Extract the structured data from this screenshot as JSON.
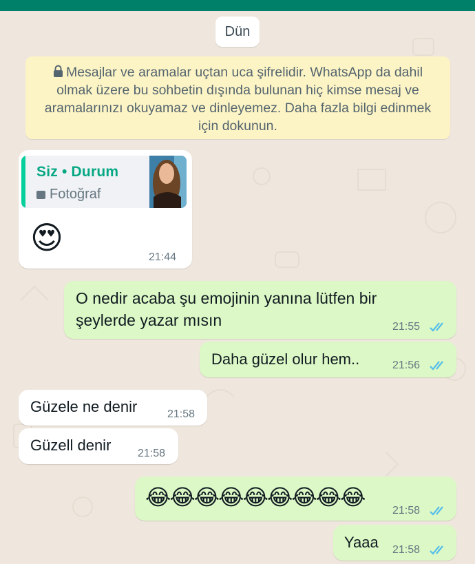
{
  "date_separator": "Dün",
  "encryption_notice": "Mesajlar ve aramalar uçtan uca şifrelidir. WhatsApp da dahil olmak üzere bu sohbetin dışında bulunan hiç kimse mesaj ve aramalarınızı okuyamaz ve dinleyemez. Daha fazla bilgi edinmek için dokunun.",
  "messages": [
    {
      "direction": "incoming",
      "reply_to": {
        "title": "Siz • Durum",
        "subtitle": "Fotoğraf"
      },
      "text": "😍",
      "time": "21:44"
    },
    {
      "direction": "outgoing",
      "lines": [
        "O nedir acaba şu emojinin yanına lütfen bir",
        "şeylerde yazar mısın"
      ],
      "time": "21:55",
      "status": "read"
    },
    {
      "direction": "outgoing",
      "text": "Daha güzel olur hem..",
      "time": "21:56",
      "status": "read"
    },
    {
      "direction": "incoming",
      "text": "Güzele ne denir",
      "time": "21:58"
    },
    {
      "direction": "incoming",
      "text": "Güzell denir",
      "time": "21:58"
    },
    {
      "direction": "outgoing",
      "text": "😂😂😂😂😂😂😂😂😂",
      "time": "21:58",
      "status": "read"
    },
    {
      "direction": "outgoing",
      "text": "Yaaa",
      "time": "21:58",
      "status": "read"
    }
  ],
  "colors": {
    "header": "#008069",
    "outgoing_bubble": "#dcf8c6",
    "incoming_bubble": "#ffffff",
    "read_ticks": "#53bdeb",
    "notice_bg": "#fdf4c5"
  }
}
